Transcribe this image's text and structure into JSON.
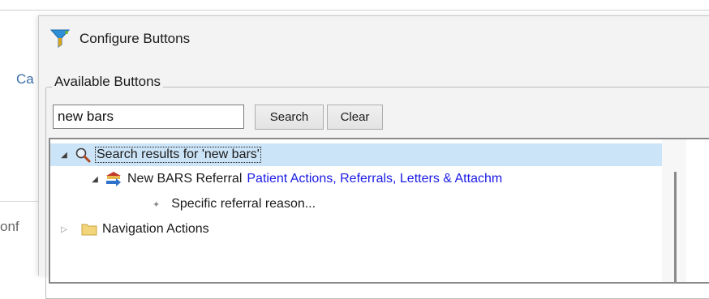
{
  "background": {
    "left_label_1": "Ca",
    "left_label_2": "onf"
  },
  "dialog": {
    "title": "Configure Buttons",
    "title_icon": "funnel-icon"
  },
  "available_buttons": {
    "legend": "Available Buttons",
    "search_value": "new bars",
    "search_button_label": "Search",
    "clear_button_label": "Clear"
  },
  "tree": {
    "rows": [
      {
        "label": "Search results for 'new bars'",
        "expander": "expanded",
        "icon": "magnifier-icon",
        "selected": true
      },
      {
        "label": "New BARS Referral",
        "category": "Patient Actions, Referrals, Letters & Attachm",
        "expander": "expanded",
        "icon": "referral-arrow-icon"
      },
      {
        "label": "Specific referral reason...",
        "icon": "bullet-icon"
      },
      {
        "label": "Navigation Actions",
        "expander": "collapsed",
        "icon": "folder-icon"
      }
    ]
  },
  "colors": {
    "selection": "#cce4f7",
    "category_link": "#1a1ae6",
    "window_bg": "#f3f3f3"
  }
}
